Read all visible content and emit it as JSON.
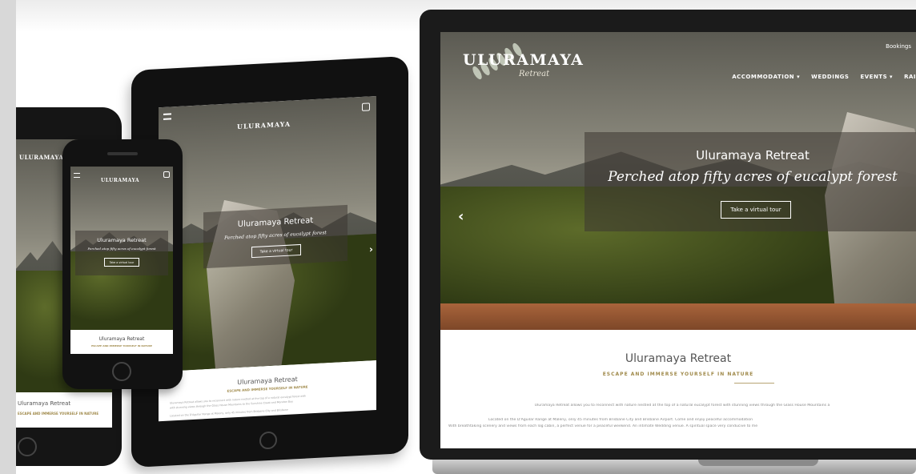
{
  "laptop": {
    "logo": "ULURAMAYA",
    "logo_sub": "Retreat",
    "bookings": "Bookings",
    "nav": [
      "ACCOMMODATION ▾",
      "WEDDINGS",
      "EVENTS ▾",
      "RAI"
    ],
    "hero_title": "Uluramaya Retreat",
    "hero_tagline": "Perched atop fifty acres of eucalypt forest",
    "hero_button": "Take a virtual tour",
    "prev_arrow": "‹",
    "section_title": "Uluramaya Retreat",
    "section_subtitle": "ESCAPE AND IMMERSE YOURSELF IN NATURE",
    "paragraphs": [
      "Uluramaya Retreat allows you to reconnect with nature nestled at the top of a natural eucalypt forest with stunning views through the Glass House Mountains a",
      "Located on the D'Aguilar Range at Maleny, only 45 minutes from Brisbane City and Brisbane Airport. Come and enjoy peaceful accommodation",
      "With breathtaking scenery and views from each log cabin, a perfect venue for a peaceful weekend. An intimate Wedding venue. A spiritual space very conducive to me"
    ]
  },
  "tablet": {
    "logo": "ULURAMAYA",
    "hero_title": "Uluramaya Retreat",
    "hero_tagline": "Perched atop fifty acres of eucalypt forest",
    "hero_button": "Take a virtual tour",
    "next_arrow": "›",
    "section_title": "Uluramaya Retreat",
    "section_subtitle": "ESCAPE AND IMMERSE YOURSELF IN NATURE",
    "paragraphs": [
      "Uluramaya Retreat allows you to reconnect with nature nestled at the top of a natural eucalypt forest with",
      "with stunning views through the Glass House Mountains to the Sunshine Coast and Moreton Bay",
      "Located on the D'Aguilar Range at Maleny, only 45 minutes from Brisbane City and Brisbane"
    ]
  },
  "phone": {
    "logo": "ULURAMAYA",
    "hero_title": "Uluramaya Retreat",
    "hero_tagline": "Perched atop fifty acres of eucalypt forest",
    "hero_button": "Take a virtual tour",
    "section_title": "Uluramaya Retreat",
    "section_subtitle": "ESCAPE AND IMMERSE YOURSELF IN NATURE"
  },
  "phone_back": {
    "logo": "ULURAMAYA",
    "section_title": "Uluramaya Retreat",
    "section_subtitle": "ESCAPE AND IMMERSE YOURSELF IN NATURE"
  }
}
